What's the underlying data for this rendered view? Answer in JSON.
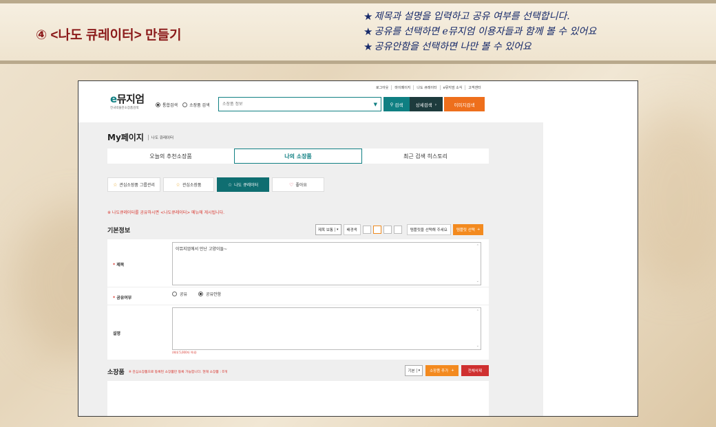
{
  "lesson": {
    "title": "④ <나도 큐레이터> 만들기",
    "notes": [
      "제목과 설명을 입력하고 공유 여부를 선택합니다.",
      "공유를 선택하면 e뮤지엄 이용자들과 함께 볼 수 있어요",
      "공유안함을 선택하면 나만 볼 수 있어요"
    ]
  },
  "site": {
    "logo": {
      "e": "e",
      "name": "뮤지엄",
      "subtitle": "전국박물관소장품검색"
    },
    "toplinks": [
      "로그아웃",
      "마이페이지",
      "나도 큐레이터",
      "e뮤지엄 소식",
      "고객센터"
    ],
    "search_scope": {
      "option1": "통합검색",
      "option2": "소장품 검색",
      "selected": "option1"
    },
    "search": {
      "placeholder": "소장품 정보",
      "dropdown_icon": "triangle-down-icon"
    },
    "buttons": {
      "search": "검색",
      "detail": "상세검색",
      "image": "이미지검색"
    }
  },
  "mypage": {
    "title": "My페이지",
    "breadcrumb": "나도 큐레이터",
    "tabs": [
      {
        "label": "오늘의 추천소장품",
        "active": false
      },
      {
        "label": "나의 소장품",
        "active": true
      },
      {
        "label": "최근 검색 히스토리",
        "active": false
      }
    ],
    "subtabs": [
      {
        "label": "관심소장품 그룹관리",
        "icon": "star-outline-icon",
        "active": false
      },
      {
        "label": "관심소장품",
        "icon": "star-outline-icon",
        "active": false
      },
      {
        "label": "나도 큐레이터",
        "icon": "star-outline-icon",
        "active": true
      },
      {
        "label": "좋아요",
        "icon": "heart-outline-icon",
        "active": false
      }
    ],
    "notice": "※ 나도큐레이터를 공유하시면 <나도큐레이터> 메뉴에 게시됩니다."
  },
  "basic_info": {
    "title": "기본정보",
    "select_value": "제목 보통",
    "bg_label": "배경색",
    "template_label": "템플릿을 선택해 주세요",
    "template_button": "템플릿 선택",
    "fields": {
      "title_label": "제목",
      "title_value": "이뮤지엄에서 만난 고양이들~",
      "share_label": "공유여부",
      "share_on": "공유",
      "share_off": "공유안함",
      "share_selected": "공유안함",
      "desc_label": "설명",
      "desc_limit": "(최대 5,000자 이내)"
    },
    "colors": {
      "accent": "#0f7f82",
      "orange": "#f38a1f",
      "red": "#cf3030"
    }
  },
  "items": {
    "title": "소장품",
    "note": "※ 관심소장품으로 등록된 소장품만 등록 가능합니다.  현재 소장품 : 0개",
    "view_select": "기본",
    "add_button": "소장품 추가",
    "delete_button": "전체삭제"
  }
}
